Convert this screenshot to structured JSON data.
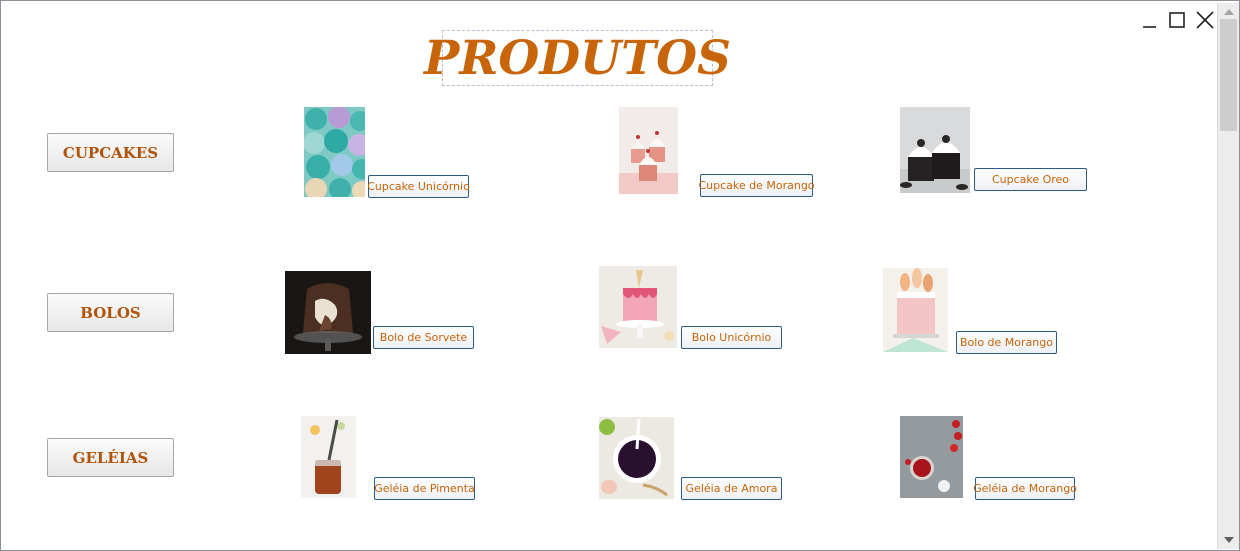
{
  "page": {
    "title": "PRODUTOS"
  },
  "categories": [
    {
      "label": "CUPCAKES"
    },
    {
      "label": "BOLOS"
    },
    {
      "label": "GELÉIAS"
    }
  ],
  "products": {
    "cupcakes": [
      {
        "label": "Cupcake Unicórnio"
      },
      {
        "label": "Cupcake de Morango"
      },
      {
        "label": "Cupcake Oreo"
      }
    ],
    "bolos": [
      {
        "label": "Bolo de Sorvete"
      },
      {
        "label": "Bolo Unicórnio"
      },
      {
        "label": "Bolo de Morango"
      }
    ],
    "geleias": [
      {
        "label": "Geléia de Pimenta"
      },
      {
        "label": "Geléia de Amora"
      },
      {
        "label": "Geléia de Morango"
      }
    ]
  },
  "window": {
    "controls": [
      "minimize-icon",
      "maximize-icon",
      "close-icon"
    ]
  },
  "colors": {
    "accent": "#c8650a",
    "button_border": "#2c5b8a"
  }
}
